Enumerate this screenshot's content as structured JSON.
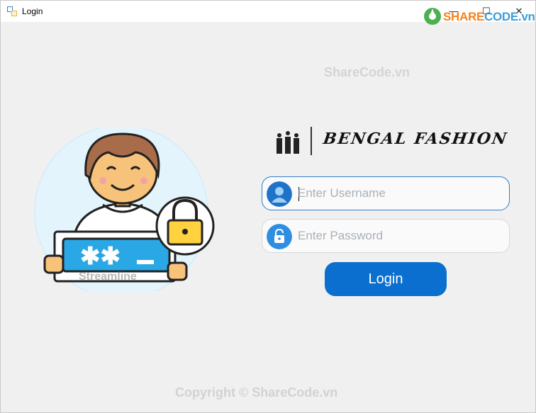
{
  "window": {
    "title": "Login",
    "min_glyph": "—",
    "max_glyph": "☐",
    "close_glyph": "✕"
  },
  "watermark": {
    "logo_brand": "SHARE",
    "logo_code": "CODE.vn",
    "top_text": "ShareCode.vn",
    "bottom_text": "Copyright © ShareCode.vn",
    "illustration_text": "Streamline"
  },
  "brand": {
    "name": "BENGAL FASHION"
  },
  "form": {
    "username": {
      "placeholder": "Enter Username",
      "value": ""
    },
    "password": {
      "placeholder": "Enter Password",
      "value": ""
    },
    "login_label": "Login"
  },
  "colors": {
    "accent": "#0a6fcf",
    "field_border_active": "#2f7fcb",
    "background": "#f0f0f0"
  }
}
